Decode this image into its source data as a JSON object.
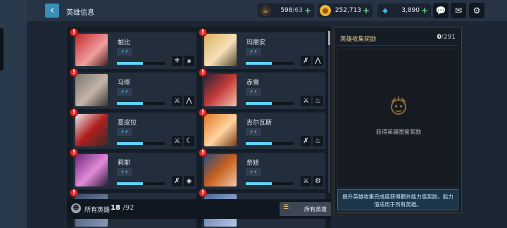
{
  "header": {
    "title": "英雄信息",
    "back_icon": "chevron-left-icon"
  },
  "resources": [
    {
      "icon": "coffee-cup-icon",
      "value": "598",
      "max": "/63",
      "color": "#e7d2a6"
    },
    {
      "icon": "gold-coin-icon",
      "value": "252,713",
      "max": "",
      "color": "#f2b233"
    },
    {
      "icon": "diamond-icon",
      "value": "3,890",
      "max": "",
      "color": "#3ab8f0"
    }
  ],
  "top_buttons": [
    "chat-icon",
    "mail-icon",
    "settings-gear-icon"
  ],
  "heroes": [
    {
      "name": "帕比",
      "progress": 0.55,
      "stars": "⚡⚡",
      "roles": [
        "wing-icon",
        "swirl-icon"
      ],
      "portrait_colors": [
        "#c0282a",
        "#f0a0a0"
      ]
    },
    {
      "name": "玛丽安",
      "progress": 0.55,
      "stars": "⚡⚡",
      "roles": [
        "crossed-arrows-icon",
        "mountain-icon"
      ],
      "portrait_colors": [
        "#d8b060",
        "#f7e0b8"
      ]
    },
    {
      "name": "马修",
      "progress": 0.55,
      "stars": "⚡⚡",
      "roles": [
        "crossed-swords-icon",
        "mountain-icon"
      ],
      "portrait_colors": [
        "#7a7470",
        "#c4b6a8"
      ]
    },
    {
      "name": "赤雪",
      "progress": 0.55,
      "stars": "⚡⚡",
      "roles": [
        "crossed-swords-icon",
        "flame-icon"
      ],
      "portrait_colors": [
        "#2a2034",
        "#c23a3a"
      ]
    },
    {
      "name": "夏皮拉",
      "progress": 0.55,
      "stars": "⚡⚡",
      "roles": [
        "crossed-swords-icon",
        "moon-icon"
      ],
      "portrait_colors": [
        "#b0201e",
        "#e8e8ee"
      ]
    },
    {
      "name": "吉尔瓦斯",
      "progress": 0.55,
      "stars": "⚡⚡",
      "roles": [
        "crossed-arrows-icon",
        "flame-icon"
      ],
      "portrait_colors": [
        "#e07a24",
        "#ffd4a0"
      ]
    },
    {
      "name": "莉耶",
      "progress": 0.55,
      "stars": "⚡⚡",
      "roles": [
        "crossed-arrows-icon",
        "diamond-rune-icon"
      ],
      "portrait_colors": [
        "#6a2a7a",
        "#e28ad8"
      ]
    },
    {
      "name": "奈娃",
      "progress": 0.55,
      "stars": "⚡⚡",
      "roles": [
        "crossed-swords-icon",
        "gear-icon"
      ],
      "portrait_colors": [
        "#c8601e",
        "#2a4a7a"
      ]
    }
  ],
  "list_footer": {
    "label": "所有英雄",
    "count": "18",
    "total": "/92",
    "filter_label": "所有英雄"
  },
  "reward_panel": {
    "title": "英雄收集奖励",
    "count": "0",
    "total": "/291",
    "hint": "获得英雄图鉴奖励",
    "description": "提升英雄收集完成度获得额外能力值奖励，能力值适用于所有英雄。"
  }
}
